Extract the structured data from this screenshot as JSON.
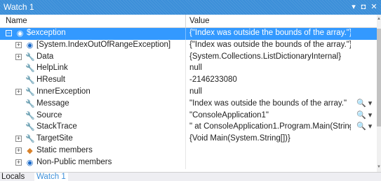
{
  "window": {
    "title": "Watch 1"
  },
  "titlebar_controls": {
    "dropdown": "▾",
    "pin": "◘",
    "close": "✕"
  },
  "columns": {
    "name": "Name",
    "value": "Value"
  },
  "rows": [
    {
      "name": "$exception",
      "value": "{\"Index was outside the bounds of the array.\"}",
      "expander": "−",
      "icon": "exception-icon",
      "glyph": "◉",
      "color": "#ffffff",
      "selected": true
    },
    {
      "name": "[System.IndexOutOfRangeException]",
      "value": "{\"Index was outside the bounds of the array.\"}",
      "expander": "+",
      "icon": "object-icon",
      "glyph": "◉",
      "color": "#1b6ac9"
    },
    {
      "name": "Data",
      "value": "{System.Collections.ListDictionaryInternal}",
      "expander": "+",
      "icon": "wrench-icon",
      "glyph": "🔧",
      "color": "#444444"
    },
    {
      "name": "HelpLink",
      "value": "null",
      "icon": "wrench-icon",
      "glyph": "🔧",
      "color": "#444444"
    },
    {
      "name": "HResult",
      "value": "-2146233080",
      "icon": "wrench-icon",
      "glyph": "🔧",
      "color": "#444444"
    },
    {
      "name": "InnerException",
      "value": "null",
      "expander": "+",
      "icon": "wrench-icon",
      "glyph": "🔧",
      "color": "#444444"
    },
    {
      "name": "Message",
      "value": "\"Index was outside the bounds of the array.\"",
      "icon": "wrench-icon",
      "glyph": "🔧",
      "color": "#444444",
      "viewer": "🔍 ▾"
    },
    {
      "name": "Source",
      "value": "\"ConsoleApplication1\"",
      "icon": "wrench-icon",
      "glyph": "🔧",
      "color": "#444444",
      "viewer": "🔍 ▾"
    },
    {
      "name": "StackTrace",
      "value": "\"   at ConsoleApplication1.Program.Main(String",
      "icon": "wrench-icon",
      "glyph": "🔧",
      "color": "#444444",
      "viewer": "🔍 ▾"
    },
    {
      "name": "TargetSite",
      "value": "{Void Main(System.String[])}",
      "expander": "+",
      "icon": "wrench-icon",
      "glyph": "🔧",
      "color": "#444444"
    },
    {
      "name": "Static members",
      "value": "",
      "expander": "+",
      "icon": "static-members-icon",
      "glyph": "◆",
      "color": "#d9822b"
    },
    {
      "name": "Non-Public members",
      "value": "",
      "expander": "+",
      "icon": "object-icon",
      "glyph": "◉",
      "color": "#1b6ac9"
    }
  ],
  "tabs": [
    {
      "label": "Locals",
      "active": false
    },
    {
      "label": "Watch 1",
      "active": true
    }
  ]
}
